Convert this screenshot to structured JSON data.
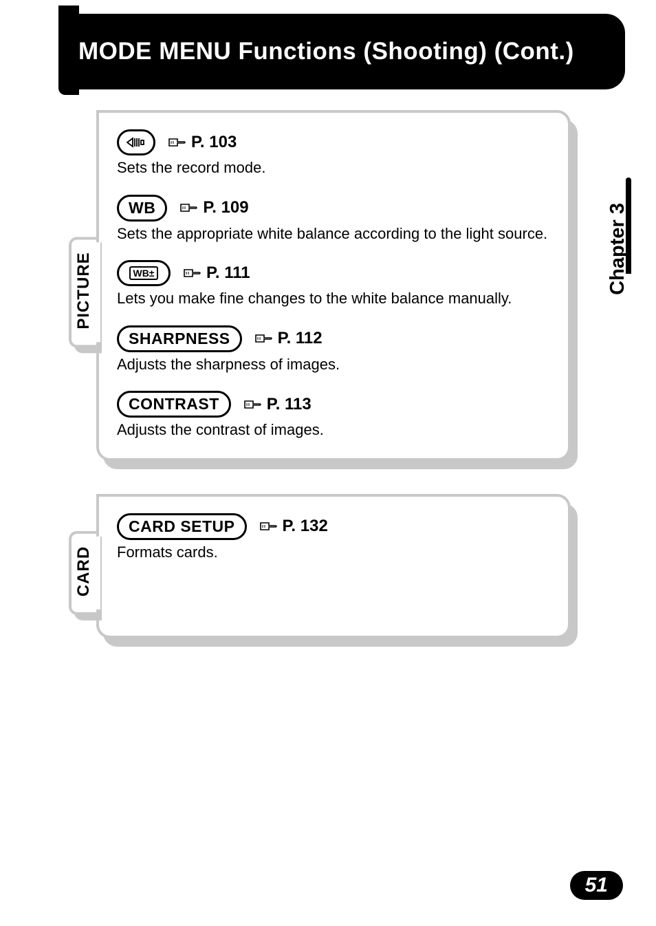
{
  "header": {
    "title": "MODE MENU Functions (Shooting) (Cont.)"
  },
  "chapter": {
    "label": "Chapter 3"
  },
  "sections": [
    {
      "tab": "PICTURE",
      "entries": [
        {
          "iconType": "record-mode",
          "page": "P. 103",
          "desc": "Sets the record mode."
        },
        {
          "label": "WB",
          "page": "P. 109",
          "desc": "Sets the appropriate white balance according to the light source."
        },
        {
          "iconType": "wb-adjust",
          "iconText": "WB±",
          "page": "P. 111",
          "desc": "Lets you make fine changes to the white balance manually."
        },
        {
          "label": "SHARPNESS",
          "page": "P. 112",
          "desc": "Adjusts the sharpness of images."
        },
        {
          "label": "CONTRAST",
          "page": "P. 113",
          "desc": "Adjusts the contrast of images."
        }
      ]
    },
    {
      "tab": "CARD",
      "entries": [
        {
          "label": "CARD SETUP",
          "page": "P. 132",
          "desc": "Formats cards."
        }
      ]
    }
  ],
  "pageNumber": "51"
}
